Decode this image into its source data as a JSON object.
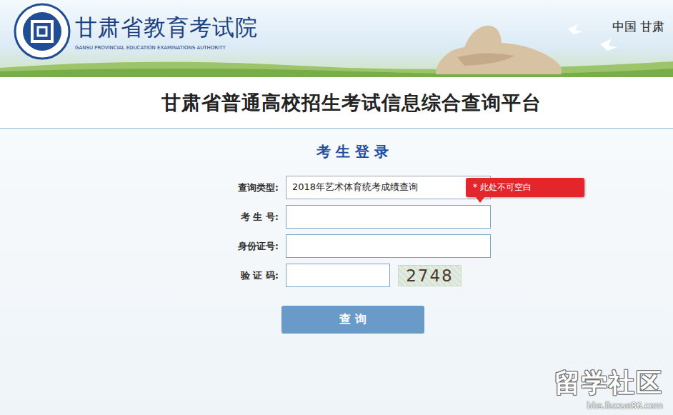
{
  "header": {
    "title": "甘肃省教育考试院",
    "subtitle": "GANSU PROVINCIAL EDUCATION EXAMINATIONS AUTHORITY",
    "region": "中国 甘肃"
  },
  "platform_title": "甘肃省普通高校招生考试信息综合查询平台",
  "login": {
    "heading": "考 生 登 录",
    "fields": [
      {
        "label": "查询类型:",
        "kind": "select",
        "value": "2018年艺术体育统考成绩查询"
      },
      {
        "label": "考 生 号:",
        "kind": "text",
        "value": ""
      },
      {
        "label": "身份证号:",
        "kind": "text",
        "value": ""
      },
      {
        "label": "验 证 码:",
        "kind": "captcha",
        "value": "",
        "captcha": "2748"
      }
    ],
    "button": "查 询"
  },
  "tooltip": "* 此处不可空白",
  "watermark": {
    "title": "留学社区",
    "url": "bbs.liuxue86.com"
  }
}
